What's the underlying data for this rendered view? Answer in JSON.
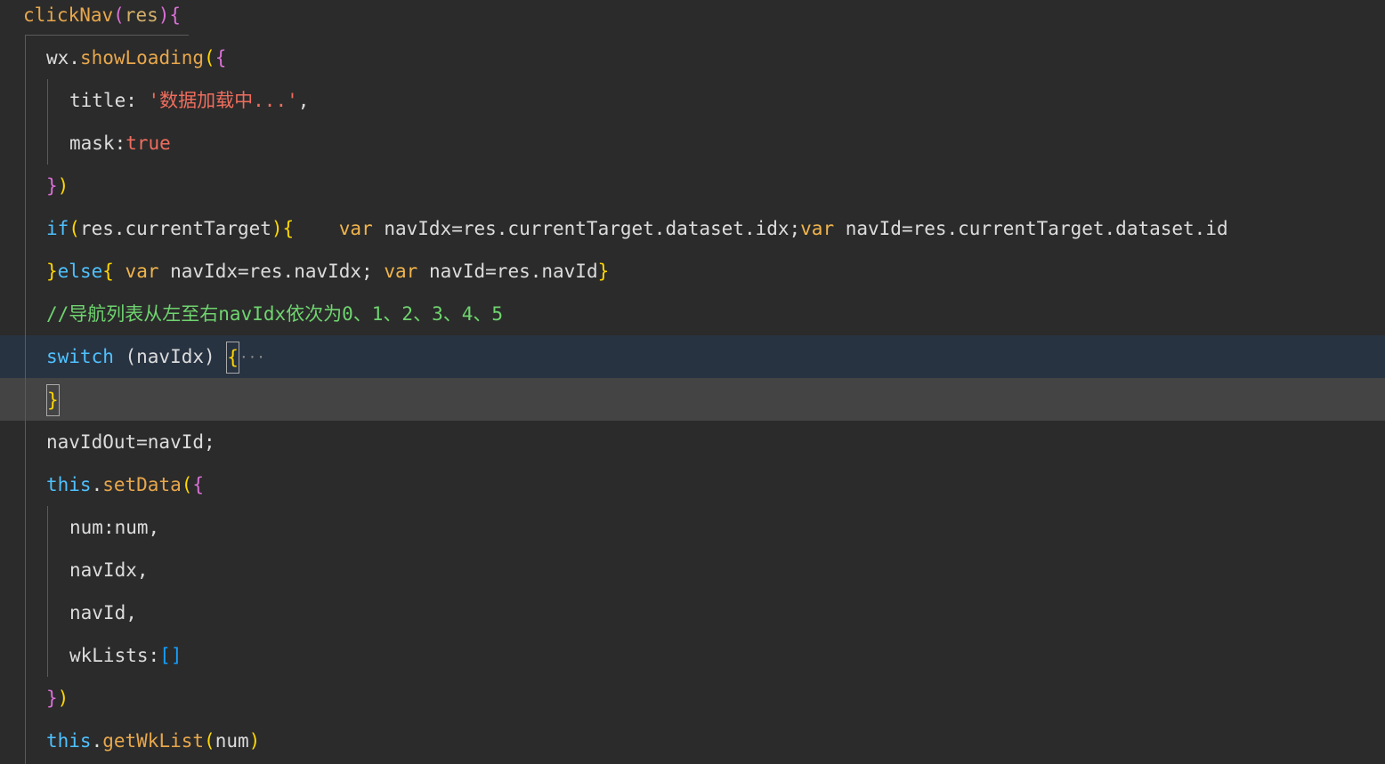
{
  "editor": {
    "lines": [
      {
        "parts": [
          "clickNav",
          "(",
          "res",
          "){"
        ]
      },
      {
        "parts": [
          "wx",
          ".",
          "showLoading",
          "(",
          "{"
        ]
      },
      {
        "parts": [
          "title",
          ": ",
          "'数据加载中...'",
          ","
        ]
      },
      {
        "parts": [
          "mask",
          ":",
          "true"
        ]
      },
      {
        "parts": [
          "}",
          ")"
        ]
      },
      {
        "parts": [
          "if",
          "(",
          "res.currentTarget",
          ")",
          "{",
          "    ",
          "var",
          " navIdx=res.currentTarget.dataset.idx;",
          "var",
          " navId=res.currentTarget.dataset.id"
        ]
      },
      {
        "parts": [
          "}",
          "else",
          "{",
          " ",
          "var",
          " navIdx=res.navIdx; ",
          "var",
          " navId=res.navId",
          "}"
        ]
      },
      {
        "parts": [
          "//导航列表从左至右navIdx依次为0、1、2、3、4、5"
        ]
      },
      {
        "parts": [
          "switch",
          " (navIdx) ",
          "{",
          "···"
        ]
      },
      {
        "parts": [
          "}"
        ]
      },
      {
        "parts": [
          "navIdOut=navId;"
        ]
      },
      {
        "parts": [
          "this",
          ".",
          "setData",
          "(",
          "{"
        ]
      },
      {
        "parts": [
          "num",
          ":",
          "num",
          ","
        ]
      },
      {
        "parts": [
          "navIdx",
          ","
        ]
      },
      {
        "parts": [
          "navId",
          ","
        ]
      },
      {
        "parts": [
          "wkLists",
          ":",
          "[]"
        ]
      },
      {
        "parts": [
          "}",
          ")"
        ]
      },
      {
        "parts": [
          "this",
          ".",
          "getWkList",
          "(",
          "num",
          ")"
        ]
      }
    ]
  }
}
